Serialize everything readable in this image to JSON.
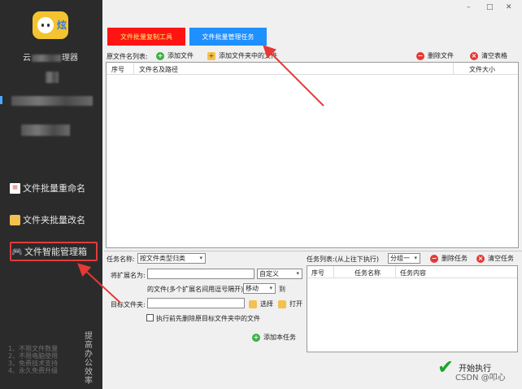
{
  "window": {
    "min_glyph": "–",
    "max_glyph": "□",
    "close_glyph": "✕"
  },
  "sidebar": {
    "logo_badge": "炫",
    "app_name_prefix": "云",
    "app_name_suffix": "理器",
    "nav": [
      {
        "label": "文件批量重命名",
        "icon": "document-icon"
      },
      {
        "label": "文件夹批量改名",
        "icon": "folder-icon"
      },
      {
        "label": "文件智能管理箱",
        "icon": "gamepad-icon"
      }
    ],
    "features": [
      "1、不限文件数量",
      "2、不限电脑使用",
      "3、免费技术支持",
      "4、永久免费升级"
    ],
    "slogan": "提高办公效率"
  },
  "tabs": {
    "copy_tool": "文件批量复制工具",
    "task_manager": "文件批量管理任务"
  },
  "source_list": {
    "label": "原文件名列表:",
    "add_file": "添加文件",
    "add_folder": "添加文件夹中的文件",
    "delete_file": "删除文件",
    "clear_table": "清空表格",
    "columns": [
      "序号",
      "文件名及路径",
      "文件大小"
    ]
  },
  "task_form": {
    "task_name_label": "任务名称:",
    "task_name_value": "按文件类型归类",
    "ext_label": "将扩展名为:",
    "ext_mode": "自定义",
    "hint": "的文件(多个扩展名间用逗号隔开)",
    "action": "移动",
    "to_label": "到",
    "target_label": "目标文件夹:",
    "choose": "选择",
    "open": "打开",
    "delete_before": "执行前先删除原目标文件夹中的文件",
    "add_task": "添加本任务"
  },
  "task_list": {
    "label": "任务列表:(从上往下执行)",
    "group": "分组一",
    "delete_task": "删除任务",
    "clear_tasks": "清空任务",
    "columns": [
      "序号",
      "任务名称",
      "任务内容"
    ]
  },
  "start_label": "开始执行",
  "watermark": "CSDN @叩心"
}
